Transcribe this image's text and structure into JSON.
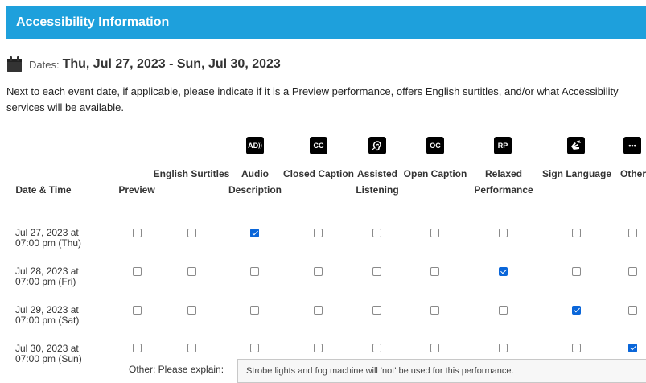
{
  "header": {
    "title": "Accessibility Information"
  },
  "dates": {
    "label": "Dates:",
    "value": "Thu, Jul 27, 2023 - Sun, Jul 30, 2023"
  },
  "intro": "Next to each event date, if applicable, please indicate if it is a Preview performance, offers English surtitles, and/or what Accessibility services will be available.",
  "columns": [
    {
      "key": "datetime",
      "label": "Date & Time"
    },
    {
      "key": "preview",
      "label": "Preview"
    },
    {
      "key": "english_surtitles",
      "label": "English Surtitles"
    },
    {
      "key": "audio_description",
      "label": "Audio Description",
      "icon_text": "AD",
      "icon": "audio-description-icon"
    },
    {
      "key": "closed_caption",
      "label": "Closed Caption",
      "icon_text": "CC",
      "icon": "closed-caption-icon"
    },
    {
      "key": "assisted_listening",
      "label": "Assisted Listening",
      "icon": "assisted-listening-ear-icon"
    },
    {
      "key": "open_caption",
      "label": "Open Caption",
      "icon_text": "OC",
      "icon": "open-caption-icon"
    },
    {
      "key": "relaxed_performance",
      "label": "Relaxed Performance",
      "icon_text": "RP",
      "icon": "relaxed-performance-icon"
    },
    {
      "key": "sign_language",
      "label": "Sign Language",
      "icon": "sign-language-hands-icon"
    },
    {
      "key": "other",
      "label": "Other",
      "icon_text": "•••",
      "icon": "other-ellipsis-icon"
    }
  ],
  "rows": [
    {
      "date_line1": "Jul 27, 2023 at",
      "date_line2": "07:00 pm (Thu)",
      "checked": [
        false,
        false,
        true,
        false,
        false,
        false,
        false,
        false,
        false
      ]
    },
    {
      "date_line1": "Jul 28, 2023 at",
      "date_line2": "07:00 pm (Fri)",
      "checked": [
        false,
        false,
        false,
        false,
        false,
        false,
        true,
        false,
        false
      ]
    },
    {
      "date_line1": "Jul 29, 2023 at",
      "date_line2": "07:00 pm (Sat)",
      "checked": [
        false,
        false,
        false,
        false,
        false,
        false,
        false,
        true,
        false
      ]
    },
    {
      "date_line1": "Jul 30, 2023 at",
      "date_line2": "07:00 pm (Sun)",
      "checked": [
        false,
        false,
        false,
        false,
        false,
        false,
        false,
        false,
        true
      ]
    }
  ],
  "other": {
    "label": "Other: Please explain:",
    "value": "Strobe lights and fog machine will 'not' be used for this performance."
  },
  "colors": {
    "header_bg": "#1ea0dc",
    "checkbox_checked": "#0a66d9"
  }
}
